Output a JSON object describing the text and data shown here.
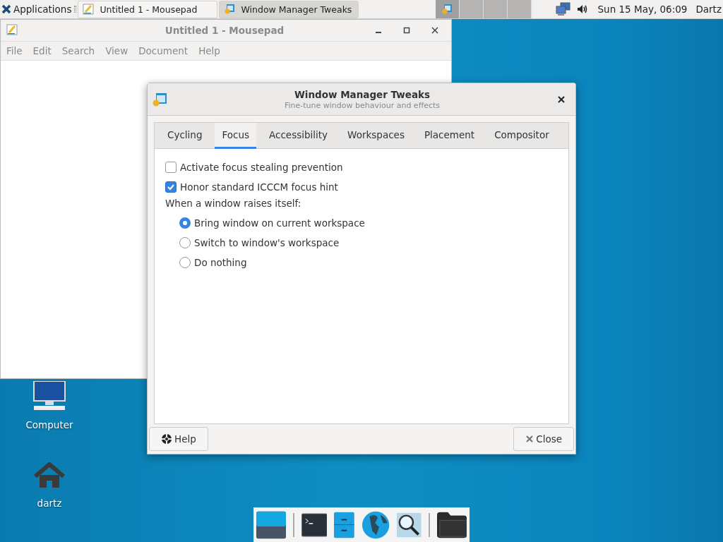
{
  "panel": {
    "applications": "Applications",
    "tasks": [
      {
        "title": "Untitled 1 - Mousepad",
        "kind": "editor",
        "selected": false
      },
      {
        "title": "Window Manager Tweaks",
        "kind": "tweaks",
        "selected": true
      }
    ],
    "workspaces": [
      {
        "selected": true
      },
      {
        "selected": false
      },
      {
        "selected": false
      },
      {
        "selected": false
      }
    ],
    "clock": "Sun 15 May, 06:09",
    "user": "Dartz"
  },
  "desktop_icons": [
    {
      "label": "Computer",
      "kind": "computer"
    },
    {
      "label": "dartz",
      "kind": "home"
    }
  ],
  "mousepad": {
    "title": "Untitled 1 - Mousepad",
    "menu": [
      "File",
      "Edit",
      "Search",
      "View",
      "Document",
      "Help"
    ]
  },
  "dialog": {
    "title": "Window Manager Tweaks",
    "subtitle": "Fine-tune window behaviour and effects",
    "tabs": [
      {
        "label": "Cycling",
        "selected": false
      },
      {
        "label": "Focus",
        "selected": true
      },
      {
        "label": "Accessibility",
        "selected": false
      },
      {
        "label": "Workspaces",
        "selected": false
      },
      {
        "label": "Placement",
        "selected": false
      },
      {
        "label": "Compositor",
        "selected": false
      }
    ],
    "checkboxes": [
      {
        "label": "Activate focus stealing prevention",
        "checked": false
      },
      {
        "label": "Honor standard ICCCM focus hint",
        "checked": true
      }
    ],
    "group_label": "When a window raises itself:",
    "radios": [
      {
        "label": "Bring window on current workspace",
        "selected": true
      },
      {
        "label": "Switch to window's workspace",
        "selected": false
      },
      {
        "label": "Do nothing",
        "selected": false
      }
    ],
    "help_button": "Help",
    "close_button": "Close"
  },
  "dock": [
    {
      "kind": "desktop"
    },
    {
      "kind": "terminal"
    },
    {
      "kind": "files-cabinet"
    },
    {
      "kind": "globe"
    },
    {
      "kind": "search"
    },
    {
      "kind": "folder"
    }
  ]
}
